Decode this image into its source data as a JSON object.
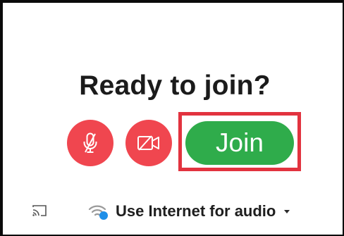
{
  "title": "Ready to join?",
  "controls": {
    "join_label": "Join",
    "mic_icon": "mic-off-icon",
    "camera_icon": "camera-off-icon"
  },
  "audio": {
    "label": "Use Internet for audio",
    "icon": "wifi-audio-icon"
  },
  "cast_icon": "cast-icon",
  "colors": {
    "danger": "#f0464f",
    "join": "#2fac4b",
    "highlight": "#e2333f",
    "audio_dot": "#1f8fe8"
  }
}
